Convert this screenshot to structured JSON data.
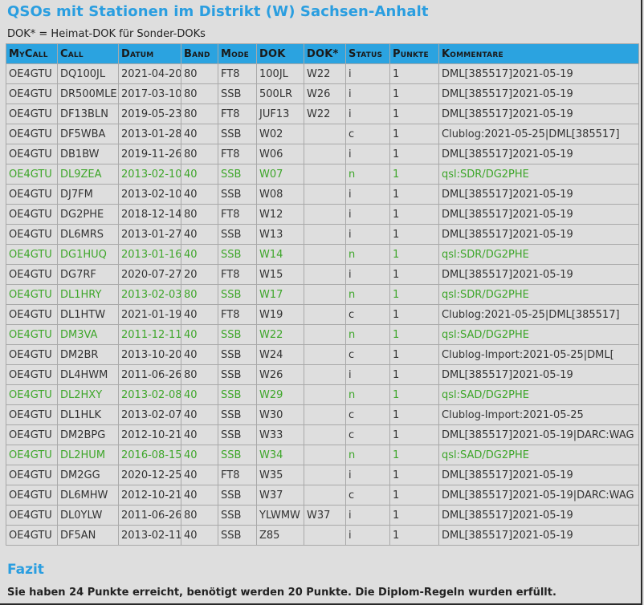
{
  "page": {
    "title": "QSOs mit Stationen im Distrikt (W) Sachsen-Anhalt",
    "note": "DOK* = Heimat-DOK für Sonder-DOKs"
  },
  "table": {
    "headers": [
      "MyCall",
      "Call",
      "Datum",
      "Band",
      "Mode",
      "DOK",
      "DOK*",
      "Status",
      "Punkte",
      "Kommentare"
    ],
    "rows": [
      {
        "cells": [
          "OE4GTU",
          "DQ100JL",
          "2021-04-20",
          "80",
          "FT8",
          "100JL",
          "W22",
          "i",
          "1",
          "DML[385517]2021-05-19"
        ],
        "highlight": false
      },
      {
        "cells": [
          "OE4GTU",
          "DR500MLE",
          "2017-03-10",
          "80",
          "SSB",
          "500LR",
          "W26",
          "i",
          "1",
          "DML[385517]2021-05-19"
        ],
        "highlight": false
      },
      {
        "cells": [
          "OE4GTU",
          "DF13BLN",
          "2019-05-23",
          "80",
          "FT8",
          "JUF13",
          "W22",
          "i",
          "1",
          "DML[385517]2021-05-19"
        ],
        "highlight": false
      },
      {
        "cells": [
          "OE4GTU",
          "DF5WBA",
          "2013-01-28",
          "40",
          "SSB",
          "W02",
          "",
          "c",
          "1",
          "Clublog:2021-05-25|DML[385517]"
        ],
        "highlight": false
      },
      {
        "cells": [
          "OE4GTU",
          "DB1BW",
          "2019-11-26",
          "80",
          "FT8",
          "W06",
          "",
          "i",
          "1",
          "DML[385517]2021-05-19"
        ],
        "highlight": false
      },
      {
        "cells": [
          "OE4GTU",
          "DL9ZEA",
          "2013-02-10",
          "40",
          "SSB",
          "W07",
          "",
          "n",
          "1",
          "qsl:SDR/DG2PHE"
        ],
        "highlight": true
      },
      {
        "cells": [
          "OE4GTU",
          "DJ7FM",
          "2013-02-10",
          "40",
          "SSB",
          "W08",
          "",
          "i",
          "1",
          "DML[385517]2021-05-19"
        ],
        "highlight": false
      },
      {
        "cells": [
          "OE4GTU",
          "DG2PHE",
          "2018-12-14",
          "80",
          "FT8",
          "W12",
          "",
          "i",
          "1",
          "DML[385517]2021-05-19"
        ],
        "highlight": false
      },
      {
        "cells": [
          "OE4GTU",
          "DL6MRS",
          "2013-01-27",
          "40",
          "SSB",
          "W13",
          "",
          "i",
          "1",
          "DML[385517]2021-05-19"
        ],
        "highlight": false
      },
      {
        "cells": [
          "OE4GTU",
          "DG1HUQ",
          "2013-01-16",
          "40",
          "SSB",
          "W14",
          "",
          "n",
          "1",
          "qsl:SDR/DG2PHE"
        ],
        "highlight": true
      },
      {
        "cells": [
          "OE4GTU",
          "DG7RF",
          "2020-07-27",
          "20",
          "FT8",
          "W15",
          "",
          "i",
          "1",
          "DML[385517]2021-05-19"
        ],
        "highlight": false
      },
      {
        "cells": [
          "OE4GTU",
          "DL1HRY",
          "2013-02-03",
          "80",
          "SSB",
          "W17",
          "",
          "n",
          "1",
          "qsl:SDR/DG2PHE"
        ],
        "highlight": true
      },
      {
        "cells": [
          "OE4GTU",
          "DL1HTW",
          "2021-01-19",
          "40",
          "FT8",
          "W19",
          "",
          "c",
          "1",
          "Clublog:2021-05-25|DML[385517]"
        ],
        "highlight": false
      },
      {
        "cells": [
          "OE4GTU",
          "DM3VA",
          "2011-12-11",
          "40",
          "SSB",
          "W22",
          "",
          "n",
          "1",
          "qsl:SAD/DG2PHE"
        ],
        "highlight": true
      },
      {
        "cells": [
          "OE4GTU",
          "DM2BR",
          "2013-10-20",
          "40",
          "SSB",
          "W24",
          "",
          "c",
          "1",
          "Clublog-Import:2021-05-25|DML["
        ],
        "highlight": false
      },
      {
        "cells": [
          "OE4GTU",
          "DL4HWM",
          "2011-06-26",
          "80",
          "SSB",
          "W26",
          "",
          "i",
          "1",
          "DML[385517]2021-05-19"
        ],
        "highlight": false
      },
      {
        "cells": [
          "OE4GTU",
          "DL2HXY",
          "2013-02-08",
          "40",
          "SSB",
          "W29",
          "",
          "n",
          "1",
          "qsl:SAD/DG2PHE"
        ],
        "highlight": true
      },
      {
        "cells": [
          "OE4GTU",
          "DL1HLK",
          "2013-02-07",
          "40",
          "SSB",
          "W30",
          "",
          "c",
          "1",
          "Clublog-Import:2021-05-25"
        ],
        "highlight": false
      },
      {
        "cells": [
          "OE4GTU",
          "DM2BPG",
          "2012-10-21",
          "40",
          "SSB",
          "W33",
          "",
          "c",
          "1",
          "DML[385517]2021-05-19|DARC:WAG"
        ],
        "highlight": false
      },
      {
        "cells": [
          "OE4GTU",
          "DL2HUM",
          "2016-08-15",
          "40",
          "SSB",
          "W34",
          "",
          "n",
          "1",
          "qsl:SAD/DG2PHE"
        ],
        "highlight": true
      },
      {
        "cells": [
          "OE4GTU",
          "DM2GG",
          "2020-12-25",
          "40",
          "FT8",
          "W35",
          "",
          "i",
          "1",
          "DML[385517]2021-05-19"
        ],
        "highlight": false
      },
      {
        "cells": [
          "OE4GTU",
          "DL6MHW",
          "2012-10-21",
          "40",
          "SSB",
          "W37",
          "",
          "c",
          "1",
          "DML[385517]2021-05-19|DARC:WAG"
        ],
        "highlight": false
      },
      {
        "cells": [
          "OE4GTU",
          "DL0YLW",
          "2011-06-26",
          "80",
          "SSB",
          "YLWMW",
          "W37",
          "i",
          "1",
          "DML[385517]2021-05-19"
        ],
        "highlight": false
      },
      {
        "cells": [
          "OE4GTU",
          "DF5AN",
          "2013-02-11",
          "40",
          "SSB",
          "Z85",
          "",
          "i",
          "1",
          "DML[385517]2021-05-19"
        ],
        "highlight": false
      }
    ]
  },
  "fazit": {
    "heading": "Fazit",
    "summary": "Sie haben 24 Punkte erreicht, benötigt werden 20 Punkte. Die Diplom-Regeln wurden erfüllt."
  },
  "colors": {
    "accent": "#2a9ee0",
    "header_bg": "#2ba3e0",
    "highlight_text": "#3ea62a",
    "background": "#dedede"
  }
}
